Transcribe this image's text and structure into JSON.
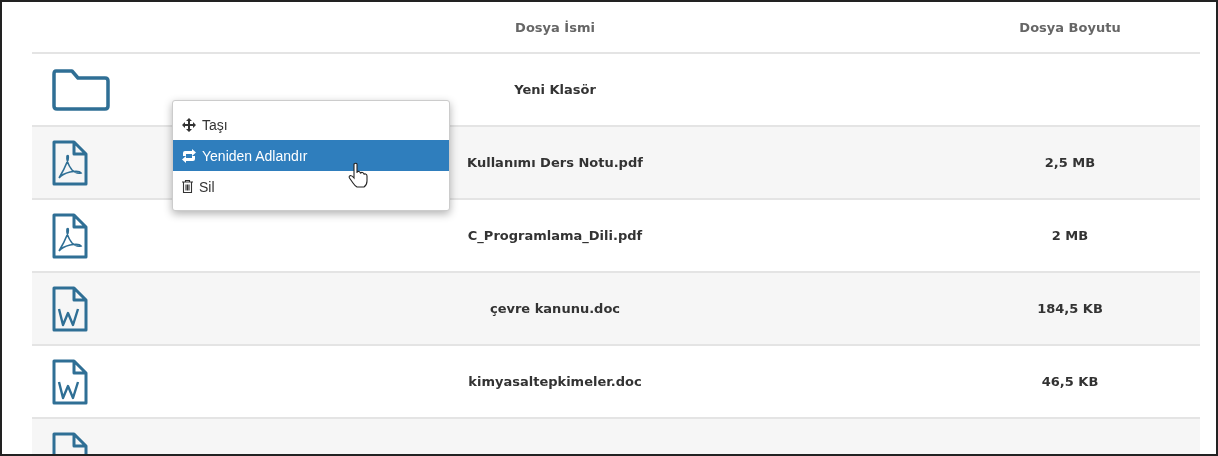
{
  "table": {
    "columns": [
      "Dosya İsmi",
      "Dosya Boyutu"
    ],
    "rows": [
      {
        "kind": "folder",
        "name": "Yeni Klasör",
        "size": ""
      },
      {
        "kind": "pdf",
        "name": "Kullanımı Ders Notu.pdf",
        "size": "2,5 MB"
      },
      {
        "kind": "pdf",
        "name": "C_Programlama_Dili.pdf",
        "size": "2 MB"
      },
      {
        "kind": "doc",
        "name": "çevre kanunu.doc",
        "size": "184,5 KB"
      },
      {
        "kind": "doc",
        "name": "kimyasaltepkimeler.doc",
        "size": "46,5 KB"
      },
      {
        "kind": "file",
        "name": "",
        "size": ""
      }
    ]
  },
  "context_menu": {
    "items": [
      {
        "kind": "move",
        "label": "Taşı",
        "selected": false
      },
      {
        "kind": "rename",
        "label": "Yeniden Adlandır",
        "selected": true
      },
      {
        "kind": "delete",
        "label": "Sil",
        "selected": false
      }
    ]
  }
}
